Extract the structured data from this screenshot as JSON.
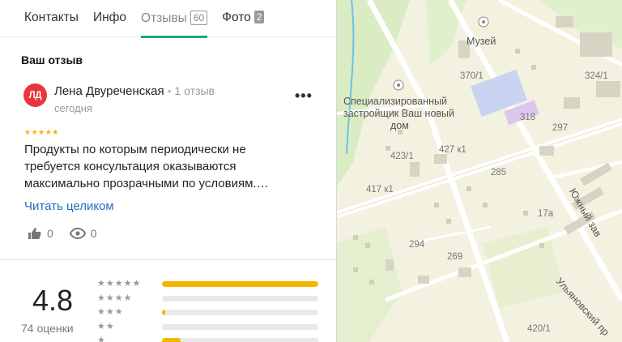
{
  "tabs": [
    {
      "label": "Контакты",
      "count": ""
    },
    {
      "label": "Инфо",
      "count": ""
    },
    {
      "label": "Отзывы",
      "count": "60",
      "active": true
    },
    {
      "label": "Фото",
      "count": "2"
    }
  ],
  "section_title": "Ваш отзыв",
  "review": {
    "avatar_initials": "ЛД",
    "author": "Лена Двуреченская",
    "author_reviews": "1 отзыв",
    "date": "сегодня",
    "stars": "★★★★★",
    "text": "Продукты по которым периодически не требуется консультация оказываются максимально прозрачными по условиям.…",
    "read_more": "Читать целиком",
    "likes": "0",
    "views": "0"
  },
  "summary": {
    "rating": "4.8",
    "count_label": "74 оценки",
    "distribution": [
      {
        "stars": "★★★★★",
        "fraction": 1.0
      },
      {
        "stars": "★★★★",
        "fraction": 0.0
      },
      {
        "stars": "★★★",
        "fraction": 0.02
      },
      {
        "stars": "★★",
        "fraction": 0.0
      },
      {
        "stars": "★",
        "fraction": 0.12
      }
    ]
  },
  "map": {
    "labels": [
      "Музей",
      "370/1",
      "324/1",
      "Специализированный",
      "застройщик Ваш новый",
      "дом",
      "318",
      "297",
      "423/1",
      "427 к1",
      "285",
      "417 к1",
      "Южный зав",
      "17а",
      "294",
      "269",
      "Ульяновский пр",
      "420/1"
    ]
  }
}
